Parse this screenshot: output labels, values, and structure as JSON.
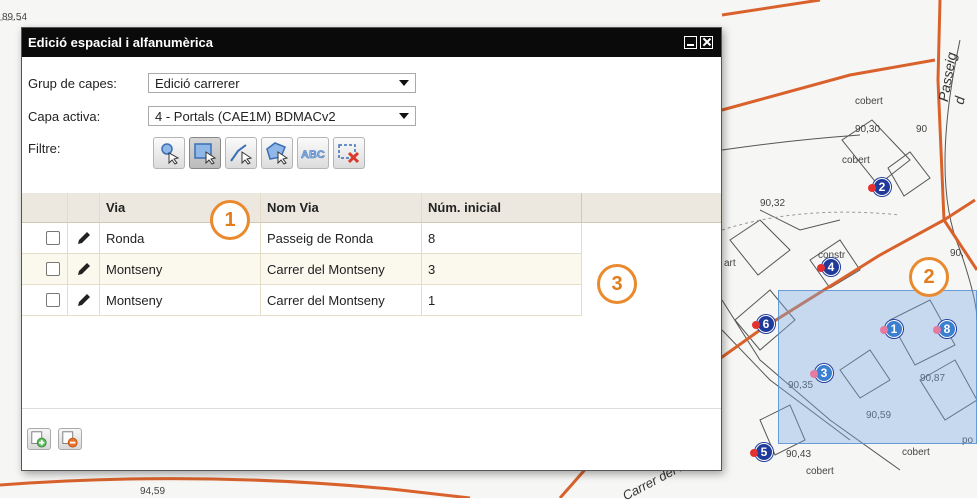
{
  "dialog": {
    "title": "Edició espacial i alfanumèrica",
    "group_label": "Grup de capes:",
    "group_value": "Edició carrerer",
    "layer_label": "Capa activa:",
    "layer_value": "4 - Portals (CAE1M) BDMACv2",
    "filter_label": "Filtre:",
    "filter_tools": [
      {
        "icon": "select-point-icon"
      },
      {
        "icon": "select-rectangle-icon",
        "active": true
      },
      {
        "icon": "select-line-icon"
      },
      {
        "icon": "select-polygon-icon"
      },
      {
        "icon": "select-text-icon"
      },
      {
        "icon": "clear-selection-icon"
      }
    ],
    "table": {
      "columns": [
        "Via",
        "Nom Via",
        "Núm. inicial"
      ],
      "rows": [
        {
          "via": "Ronda",
          "nom_via": "Passeig de Ronda",
          "num": "8"
        },
        {
          "via": "Montseny",
          "nom_via": "Carrer del Montseny",
          "num": "3"
        },
        {
          "via": "Montseny",
          "nom_via": "Carrer del Montseny",
          "num": "1"
        }
      ]
    }
  },
  "callouts": [
    "1",
    "2",
    "3"
  ],
  "map": {
    "street_label": "Passeig d",
    "street_label_2": "Carrer del Monts",
    "labels": [
      "89.54",
      "cobert",
      "90,30",
      "cobert",
      "90,32",
      "constr",
      "90,35",
      "90,87",
      "90,59",
      "90,43",
      "cobert",
      "cobert",
      "90,",
      "po",
      "art",
      "90",
      "94,59"
    ],
    "portals": [
      "2",
      "4",
      "6",
      "1",
      "8",
      "3",
      "5"
    ]
  },
  "colors": {
    "highlight": "#e98a2e",
    "street": "#d9622c",
    "selection": "#78aae6",
    "portal": "#1f3a9a"
  }
}
